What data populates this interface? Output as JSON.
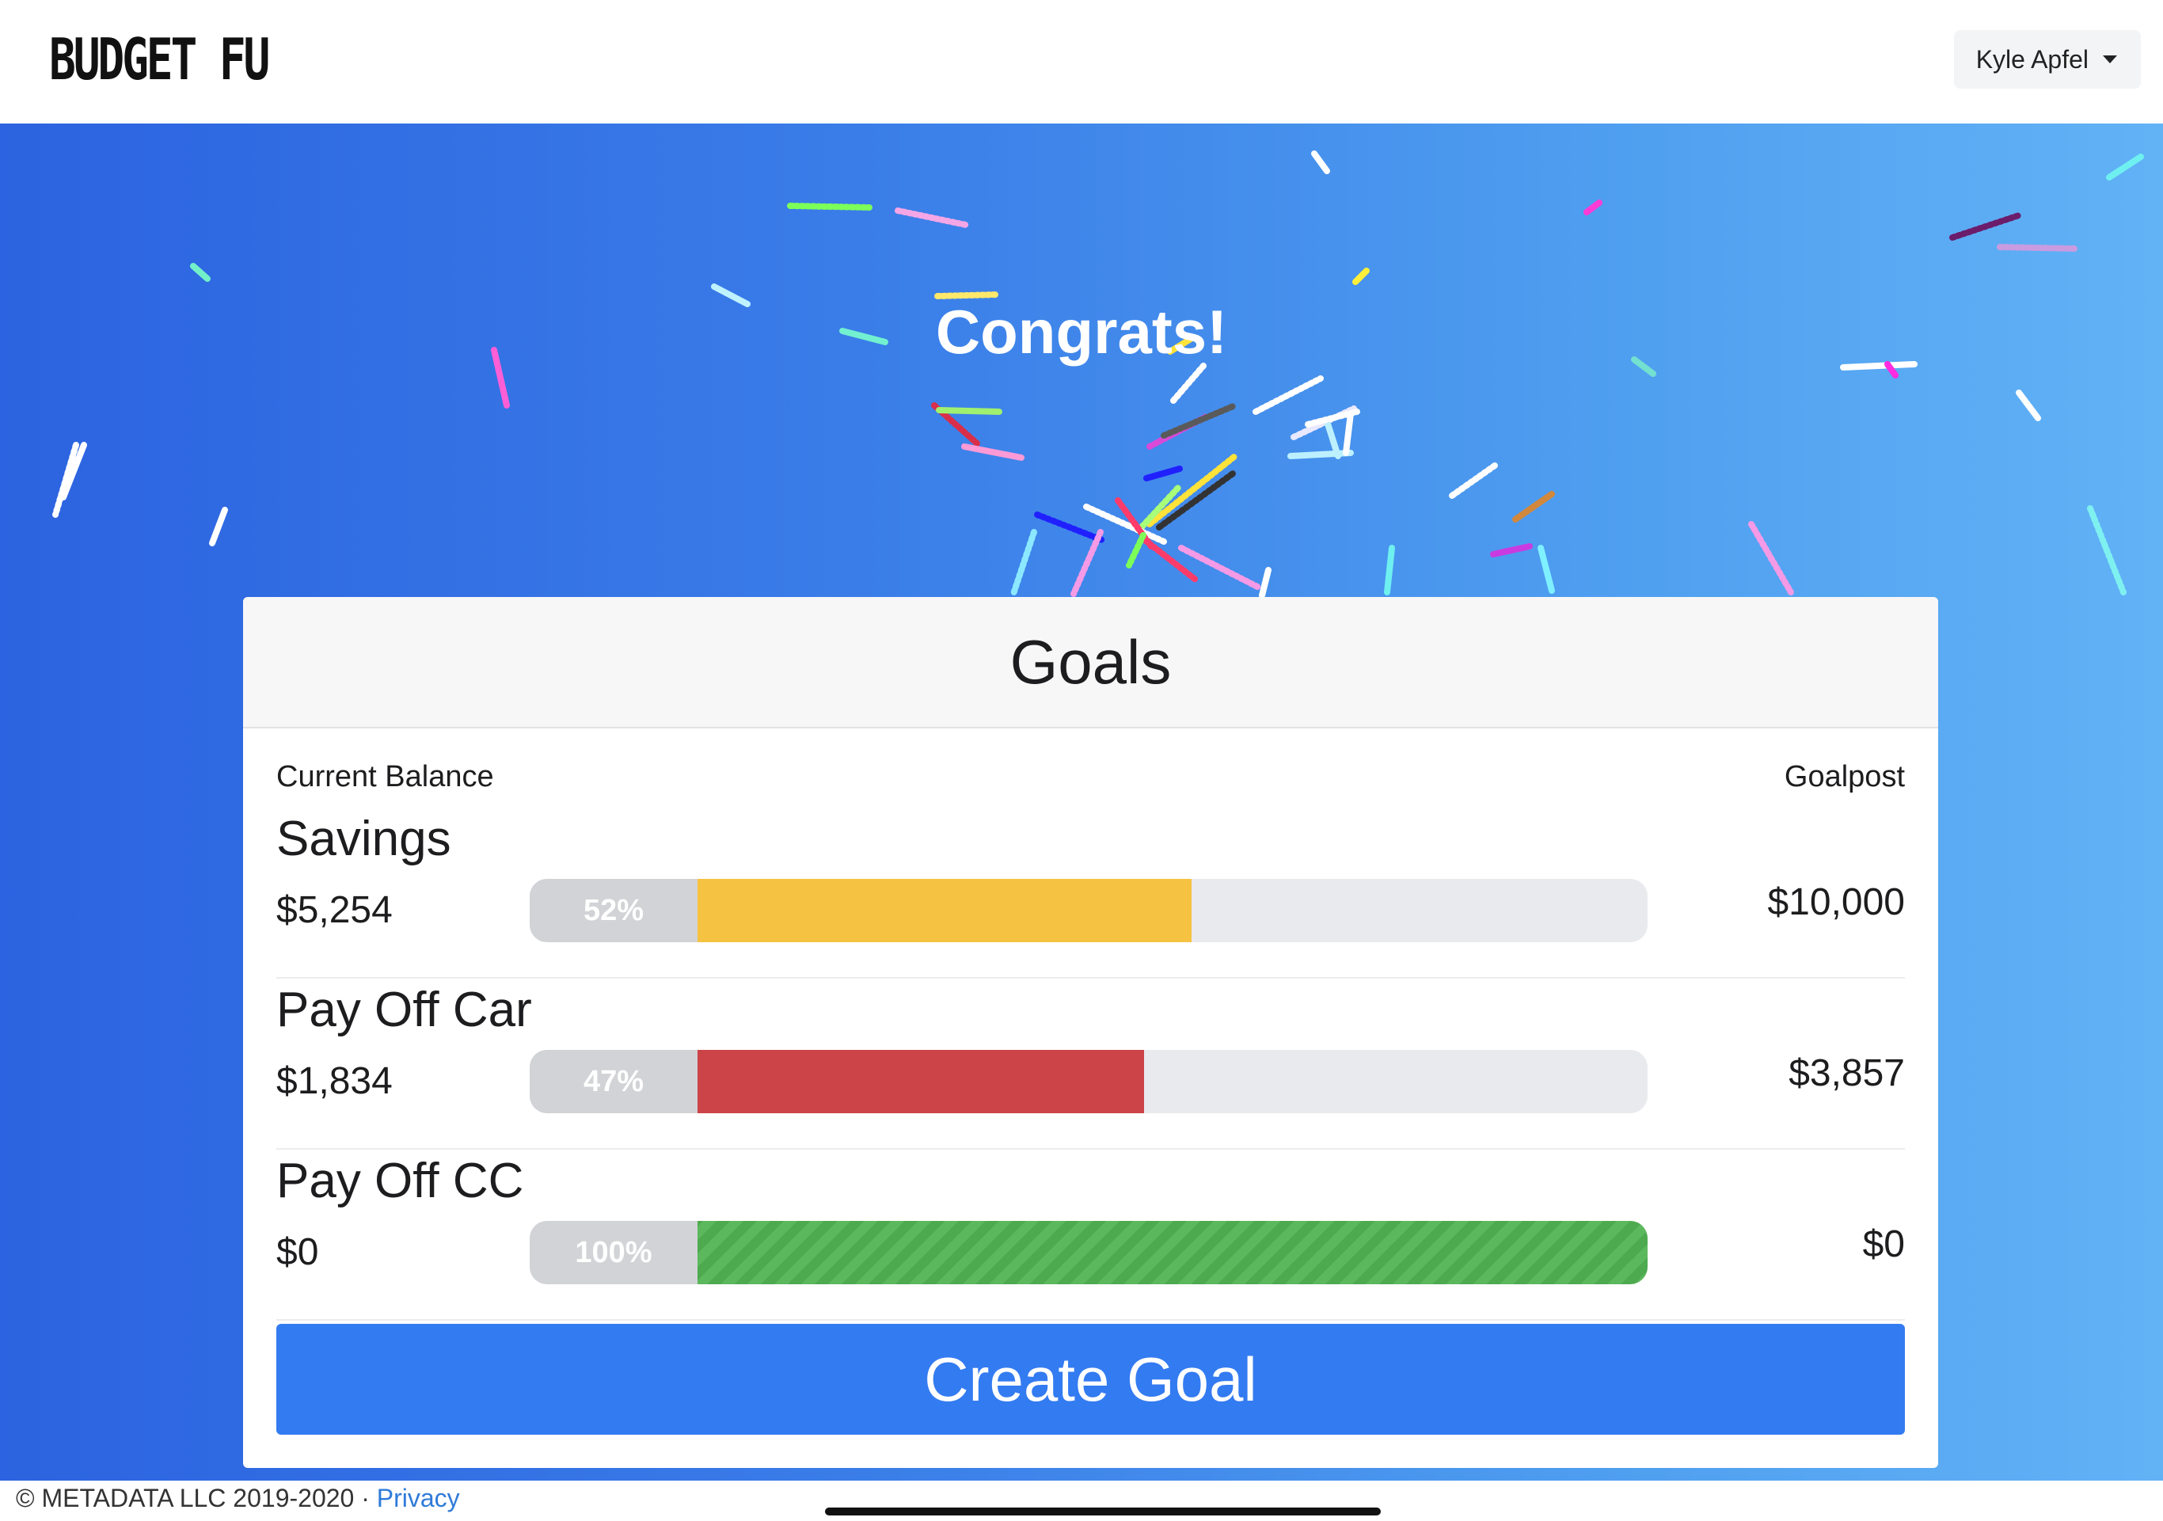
{
  "navbar": {
    "logo_text": "BUDGET FU",
    "user_name": "Kyle Apfel"
  },
  "hero": {
    "congrats_text": "Congrats!"
  },
  "goals_card": {
    "title": "Goals",
    "col_left_label": "Current Balance",
    "col_right_label": "Goalpost",
    "goals": [
      {
        "name": "Savings",
        "balance": "$5,254",
        "percent_label": "52%",
        "progress": 0.52,
        "goalpost": "$10,000",
        "color": "#f5c242"
      },
      {
        "name": "Pay Off Car",
        "balance": "$1,834",
        "percent_label": "47%",
        "progress": 0.47,
        "goalpost": "$3,857",
        "color": "#cd4448"
      },
      {
        "name": "Pay Off CC",
        "balance": "$0",
        "percent_label": "100%",
        "progress": 1.0,
        "goalpost": "$0",
        "color": "#5cb85c"
      }
    ],
    "create_button_label": "Create Goal"
  },
  "footer": {
    "copyright": "© METADATA LLC 2019-2020 · ",
    "privacy_link": "Privacy"
  },
  "colors": {
    "primary": "#337bf1",
    "hero_gradient_start": "#2c63e0",
    "hero_gradient_end": "#62b2f6"
  }
}
